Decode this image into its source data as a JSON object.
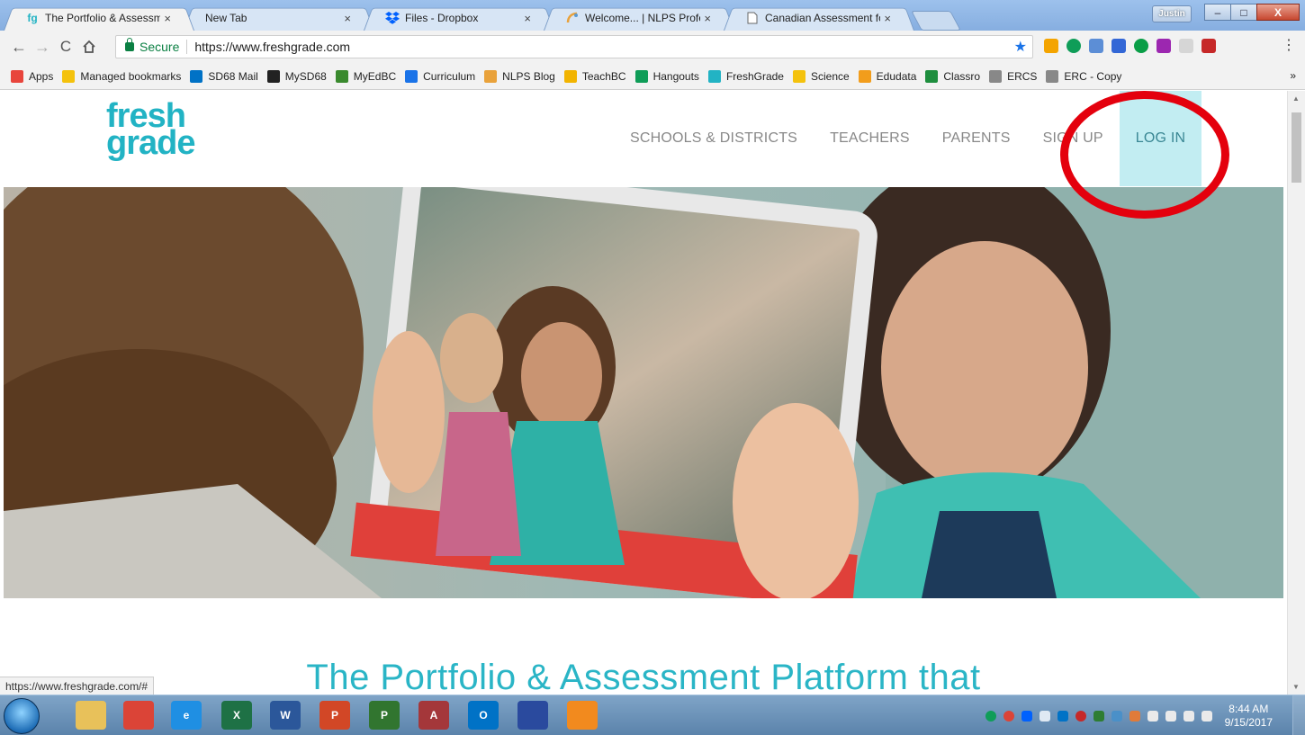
{
  "browser": {
    "tabs": [
      {
        "icon": "fg",
        "title": "The Portfolio & Assessm",
        "active": true
      },
      {
        "icon": "",
        "title": "New Tab",
        "active": false
      },
      {
        "icon": "dropbox-icon",
        "title": "Files - Dropbox",
        "active": false
      },
      {
        "icon": "nlps-icon",
        "title": "Welcome... | NLPS Profes",
        "active": false
      },
      {
        "icon": "doc-icon",
        "title": "Canadian Assessment fo",
        "active": false
      }
    ],
    "tab_close": "×",
    "user": "Justin",
    "window_buttons": {
      "minimize": "–",
      "maximize": "□",
      "close": "X"
    },
    "secure_label": "Secure",
    "url": "https://www.freshgrade.com",
    "bookmarks": [
      {
        "label": "Apps",
        "color": "#e8453c"
      },
      {
        "label": "Managed bookmarks",
        "color": "#f4c20d"
      },
      {
        "label": "SD68 Mail",
        "color": "#0072c6"
      },
      {
        "label": "MySD68",
        "color": "#222222"
      },
      {
        "label": "MyEdBC",
        "color": "#3a8a2e"
      },
      {
        "label": "Curriculum",
        "color": "#1a73e8"
      },
      {
        "label": "NLPS Blog",
        "color": "#e9a23b"
      },
      {
        "label": "TeachBC",
        "color": "#f2b400"
      },
      {
        "label": "Hangouts",
        "color": "#0f9d58"
      },
      {
        "label": "FreshGrade",
        "color": "#22b3c4"
      },
      {
        "label": "Science",
        "color": "#f4c20d"
      },
      {
        "label": "Edudata",
        "color": "#f29d1c"
      },
      {
        "label": "Classro",
        "color": "#1e8e3e"
      },
      {
        "label": "ERCS",
        "color": "#888888"
      },
      {
        "label": "ERC - Copy",
        "color": "#888888"
      }
    ],
    "bookmarks_more": "»",
    "status_url": "https://www.freshgrade.com/#"
  },
  "site": {
    "logo_line1": "fresh",
    "logo_line2": "grade",
    "nav": [
      "SCHOOLS & DISTRICTS",
      "TEACHERS",
      "PARENTS",
      "SIGN UP"
    ],
    "login": "LOG IN",
    "tagline": "The Portfolio & Assessment Platform that",
    "accent": "#22b3c4",
    "highlight": "#e4000d"
  },
  "taskbar": {
    "apps": [
      {
        "name": "file-explorer-icon",
        "label": "",
        "color": "#e8c15a"
      },
      {
        "name": "chrome-icon",
        "label": "",
        "color": "#db4437"
      },
      {
        "name": "internet-explorer-icon",
        "label": "e",
        "color": "#1f8fe3"
      },
      {
        "name": "excel-icon",
        "label": "X",
        "color": "#1e7145"
      },
      {
        "name": "word-icon",
        "label": "W",
        "color": "#2b579a"
      },
      {
        "name": "powerpoint-icon",
        "label": "P",
        "color": "#d24726"
      },
      {
        "name": "project-icon",
        "label": "P",
        "color": "#31752f"
      },
      {
        "name": "access-icon",
        "label": "A",
        "color": "#a4373a"
      },
      {
        "name": "outlook-icon",
        "label": "O",
        "color": "#0072c6"
      },
      {
        "name": "remote-desktop-icon",
        "label": "",
        "color": "#2a4a9e"
      },
      {
        "name": "media-icon",
        "label": "",
        "color": "#f28a1e"
      }
    ],
    "time": "8:44 AM",
    "date": "9/15/2017"
  }
}
